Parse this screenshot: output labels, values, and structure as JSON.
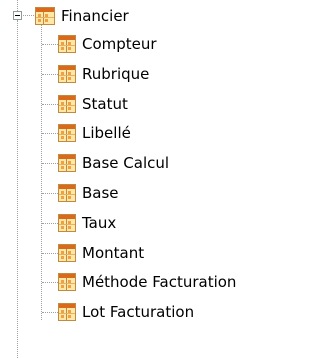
{
  "tree": {
    "root": {
      "label": "Financier",
      "expanded": true,
      "icon": "table-icon"
    },
    "children": [
      {
        "label": "Compteur",
        "icon": "table-icon"
      },
      {
        "label": "Rubrique",
        "icon": "table-icon"
      },
      {
        "label": "Statut",
        "icon": "table-icon"
      },
      {
        "label": "Libellé",
        "icon": "table-icon"
      },
      {
        "label": "Base Calcul",
        "icon": "table-icon"
      },
      {
        "label": "Base",
        "icon": "table-icon"
      },
      {
        "label": "Taux",
        "icon": "table-icon"
      },
      {
        "label": "Montant",
        "icon": "table-icon"
      },
      {
        "label": "Méthode Facturation",
        "icon": "table-icon"
      },
      {
        "label": "Lot Facturation",
        "icon": "table-icon"
      }
    ]
  },
  "colors": {
    "dots": "#a0a0a0",
    "icon_header": "#d96a1c",
    "icon_body": "#ffe7a8"
  }
}
